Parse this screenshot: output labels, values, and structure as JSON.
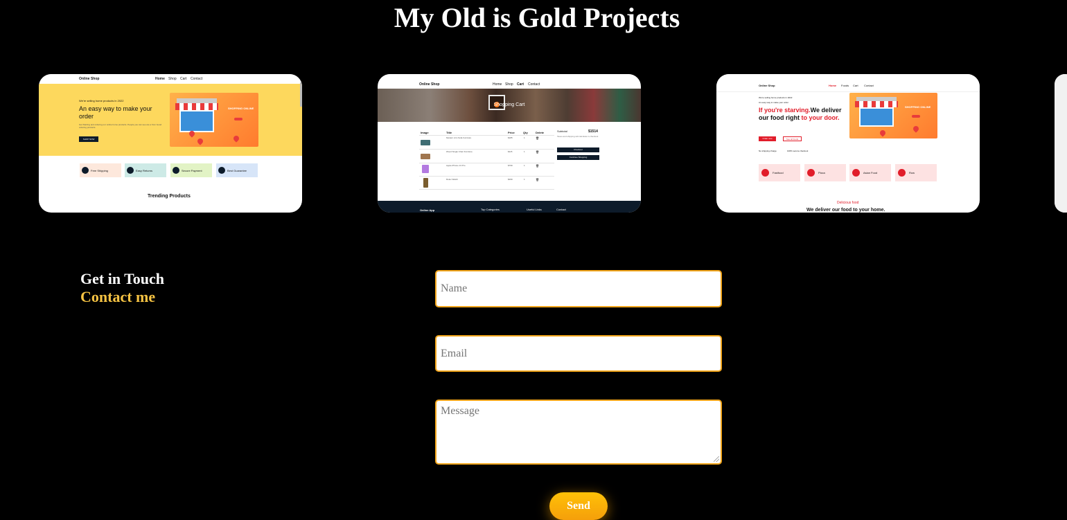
{
  "page_title": "My Old is Gold Projects",
  "projects": [
    {
      "brand": "Online Shop",
      "nav": [
        "Home",
        "Shop",
        "Cart",
        "Contact"
      ],
      "hero_small": "We're selling home products in 2022",
      "hero_title": "An easy way to make your order",
      "hero_desc": "Get Starting and ordering our online home products. People you can see are a from Good ordering products.",
      "shop_now": "SHOP NOW",
      "illustration_text": "SHOPPING ONLINE",
      "features": [
        "Free Shipping",
        "Easy Returns",
        "Secure Payment",
        "Best Guarantee"
      ],
      "section_title": "Trending Products"
    },
    {
      "brand": "Online Shop",
      "nav": [
        "Home",
        "Shop",
        "Cart",
        "Contact"
      ],
      "banner_title": "Shopping Cart",
      "table_headers": [
        "Image",
        "Title",
        "Price",
        "Qty",
        "Delete"
      ],
      "items": [
        {
          "title": "Modern Arm Sofa Furniture",
          "price": "$185",
          "qty": "1"
        },
        {
          "title": "Wood Single Chair Furniture",
          "price": "$115",
          "qty": "1"
        },
        {
          "title": "Apple iPhone 13 Pro",
          "price": "$799",
          "qty": "1"
        },
        {
          "title": "Rolex Watch",
          "price": "$299",
          "qty": "1"
        }
      ],
      "subtotal_label": "Subtotal",
      "subtotal_value": "$1514",
      "note": "Taxes and shipping will calculate in checkout",
      "checkout": "Checkout",
      "continue": "Continue Shopping",
      "footer_brand": "Online App",
      "footer_cols": [
        "Top Categories",
        "Useful Links",
        "Contact"
      ]
    },
    {
      "brand": "Online Shop",
      "nav": [
        "Home",
        "Foods",
        "Cart",
        "Contact"
      ],
      "hero_small": "We're selling home products in 2022",
      "hero_small2": "An easy way to make your order",
      "headline_red1": "If you're starving.",
      "headline_black1": "We deliver",
      "headline_black2": "our food right",
      "headline_red2": "to your door.",
      "order_now": "Order now",
      "see_all": "See all foods",
      "perk1": "No shipping charge",
      "perk2": "100% secure checkout",
      "categories": [
        "Fastfood",
        "Pizza",
        "Asian Food",
        "Row"
      ],
      "section_kicker": "Delicious food",
      "section_title": "We deliver our food to your home."
    }
  ],
  "contact": {
    "heading": "Get in Touch",
    "subheading": "Contact me",
    "name_placeholder": "Name",
    "email_placeholder": "Email",
    "message_placeholder": "Message",
    "send_label": "Send"
  },
  "colors": {
    "background": "#000000",
    "accent": "#f6c343",
    "field_border": "#f2a51a",
    "button": "#ffc107"
  }
}
